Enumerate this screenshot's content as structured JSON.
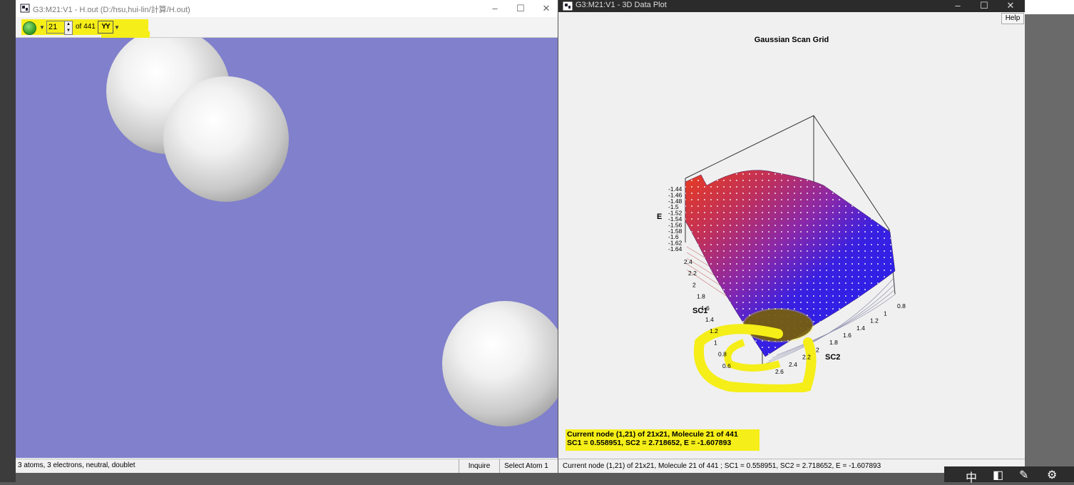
{
  "left_window": {
    "title": "G3:M21:V1 - H.out (D:/hsu,hui-lin/計算/H.out)",
    "toolbar": {
      "frame_value": "21",
      "frame_of": "of 441",
      "anim_label": "YY"
    },
    "status": {
      "text": "3 atoms, 3 electrons, neutral, doublet",
      "inquire": "Inquire",
      "select_atom": "Select Atom 1"
    }
  },
  "right_window": {
    "title": "G3:M21:V1 - 3D Data Plot",
    "menu": {
      "help": "Help"
    },
    "plot": {
      "title": "Gaussian Scan Grid",
      "e_label": "E",
      "sc1_label": "SC1",
      "sc2_label": "SC2",
      "e_ticks": [
        "-1.44",
        "-1.46",
        "-1.48",
        "-1.5",
        "-1.52",
        "-1.54",
        "-1.56",
        "-1.58",
        "-1.6",
        "-1.62",
        "-1.64"
      ],
      "sc1_ticks": [
        "2.4",
        "2.2",
        "2",
        "1.8",
        "1.6",
        "1.4",
        "1.2",
        "1",
        "0.8",
        "0.6"
      ],
      "sc2_ticks": [
        "2.6",
        "2.4",
        "2.2",
        "2",
        "1.8",
        "1.6",
        "1.4",
        "1.2",
        "1",
        "0.8"
      ]
    },
    "node_info": {
      "line1": "Current node (1,21) of 21x21, Molecule 21 of 441",
      "line2": "SC1 = 0.558951, SC2 = 2.718652, E = -1.607893"
    },
    "status_text": "Current node (1,21) of 21x21, Molecule 21 of 441 ; SC1 = 0.558951, SC2 = 2.718652, E = -1.607893"
  },
  "colors": {
    "viewport_bg": "#8080cc",
    "highlight": "#f5ee18",
    "surface_high": "#e83c1e",
    "surface_low": "#1f1ff0"
  },
  "tray": {
    "ime": "中"
  }
}
